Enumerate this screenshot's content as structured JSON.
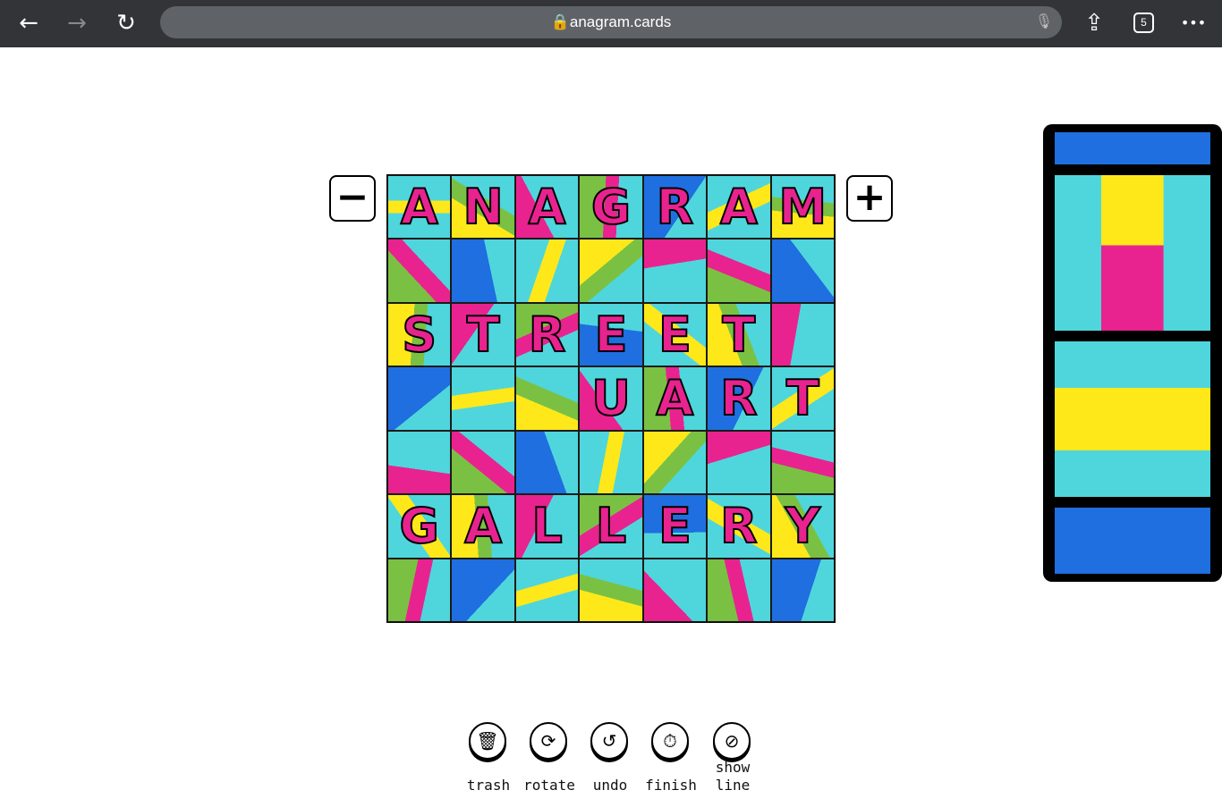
{
  "browser": {
    "url": "anagram.cards",
    "tab_count": "5",
    "back_icon": "←",
    "forward_icon": "→",
    "reload_icon": "↻",
    "share_icon": "⇪",
    "more_icon": "•••",
    "mic_icon": "🎙"
  },
  "zoom": {
    "out_label": "−",
    "in_label": "+"
  },
  "board": {
    "rows": [
      [
        "A",
        "N",
        "A",
        "G",
        "R",
        "A",
        "M"
      ],
      [
        "",
        "",
        "",
        "",
        "",
        "",
        ""
      ],
      [
        "S",
        "T",
        "R",
        "E",
        "E",
        "T",
        ""
      ],
      [
        "",
        "",
        "",
        "U",
        "A",
        "R",
        "T"
      ],
      [
        "",
        "",
        "",
        "",
        "",
        "",
        ""
      ],
      [
        "G",
        "A",
        "L",
        "L",
        "E",
        "R",
        "Y"
      ],
      [
        "",
        "",
        "",
        "",
        "",
        "",
        ""
      ]
    ],
    "palette": [
      "#4fd6dc",
      "#ffe81a",
      "#e8238f",
      "#7ac143",
      "#1f6fe0"
    ]
  },
  "toolbar": [
    {
      "label": "trash",
      "icon": "🗑"
    },
    {
      "label": "rotate",
      "icon": "⟳"
    },
    {
      "label": "undo",
      "icon": "↺"
    },
    {
      "label": "finish",
      "icon": "⏱"
    },
    {
      "label": "show\nline",
      "icon": "⊘"
    }
  ]
}
